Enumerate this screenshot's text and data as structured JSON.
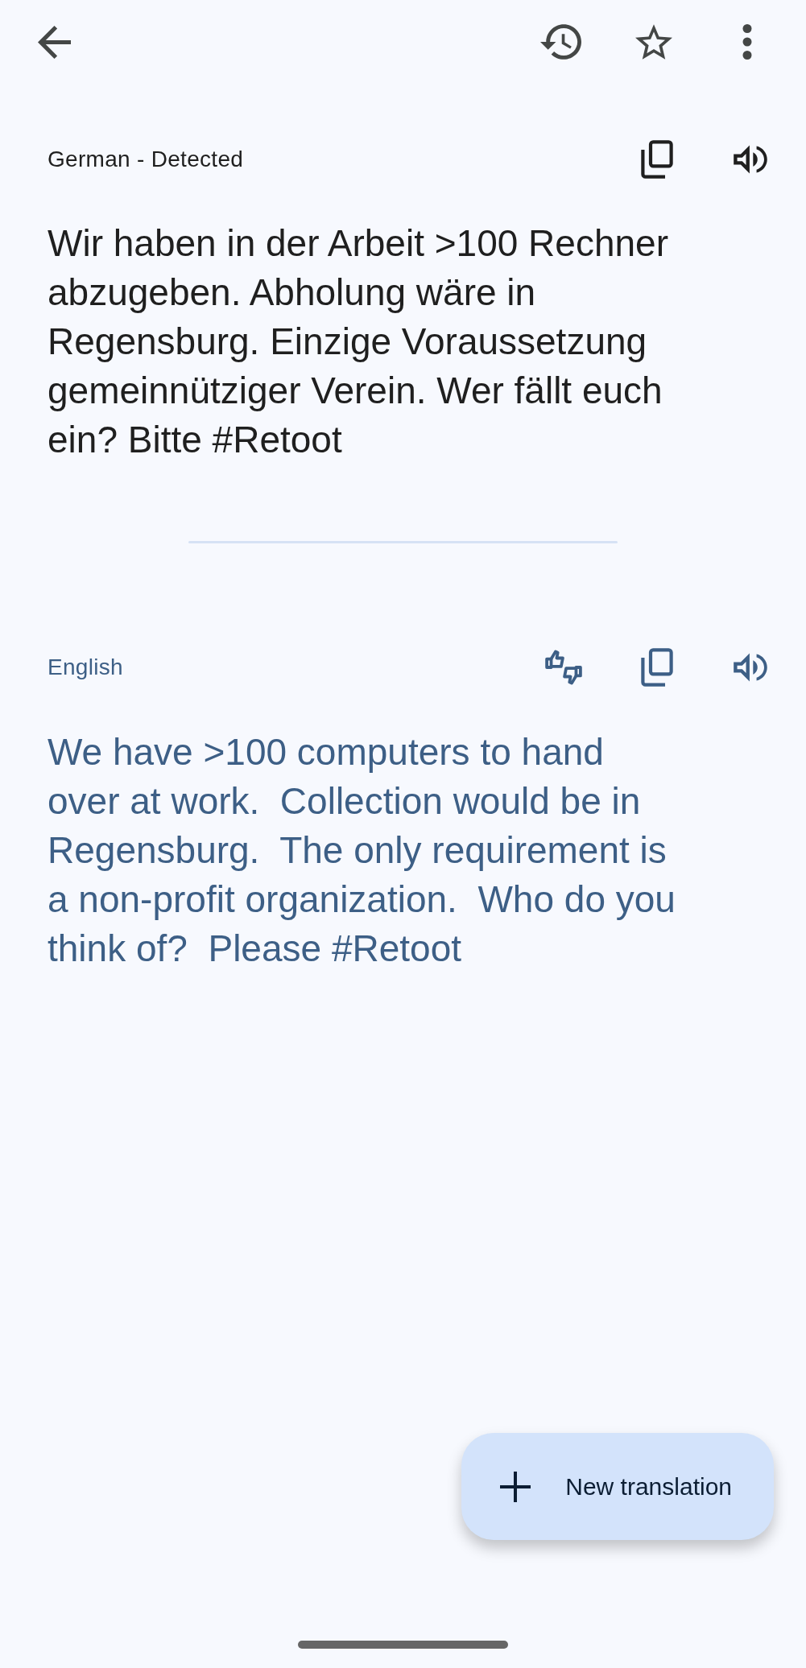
{
  "toolbar": {
    "starred": false
  },
  "source": {
    "language": "German - Detected",
    "text": "Wir haben in der Arbeit >100 Rechner abzugeben. Abholung wäre in Regensburg. Einzige Voraussetzung gemeinnütziger Verein. Wer fällt euch ein? Bitte #Retoot"
  },
  "target": {
    "language": "English",
    "text": "We have >100 computers to hand over at work.  Collection would be in Regensburg.  The only requirement is a non-profit organization.  Who do you think of?  Please #Retoot"
  },
  "fab": {
    "label": "New translation"
  }
}
